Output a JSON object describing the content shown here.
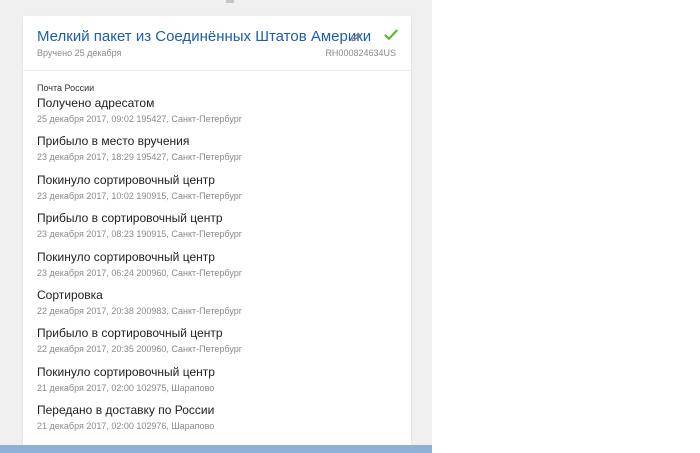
{
  "header": {
    "title": "Мелкий пакет из Соединённых Штатов Америки",
    "subtitle": "Вручено 25 декабря",
    "tracking_number": "RH000824634US"
  },
  "provider": "Почта России",
  "events": [
    {
      "status": "Получено адресатом",
      "details": "25 декабря 2017, 09:02 195427, Санкт-Петербург"
    },
    {
      "status": "Прибыло в место вручения",
      "details": "23 декабря 2017, 18:29 195427, Санкт-Петербург"
    },
    {
      "status": "Покинуло сортировочный центр",
      "details": "23 декабря 2017, 10:02 190915, Санкт-Петербург"
    },
    {
      "status": "Прибыло в сортировочный центр",
      "details": "23 декабря 2017, 08:23 190915, Санкт-Петербург"
    },
    {
      "status": "Покинуло сортировочный центр",
      "details": "23 декабря 2017, 06:24 200960, Санкт-Петербург"
    },
    {
      "status": "Сортировка",
      "details": "22 декабря 2017, 20:38 200983, Санкт-Петербург"
    },
    {
      "status": "Прибыло в сортировочный центр",
      "details": "22 декабря 2017, 20:35 200960, Санкт-Петербург"
    },
    {
      "status": "Покинуло сортировочный центр",
      "details": "21 декабря 2017, 02:00 102975, Шарапово"
    },
    {
      "status": "Передано в доставку по России",
      "details": "21 декабря 2017, 02:00 102976, Шарапово"
    }
  ],
  "icons": {
    "edit": "pencil-icon",
    "delivered": "check-icon"
  },
  "colors": {
    "title": "#1b5db0",
    "check": "#5fb336",
    "muted_text": "#8a8a8a",
    "background": "#f0f0f0",
    "bottom_bar": "#8fb0d6"
  }
}
